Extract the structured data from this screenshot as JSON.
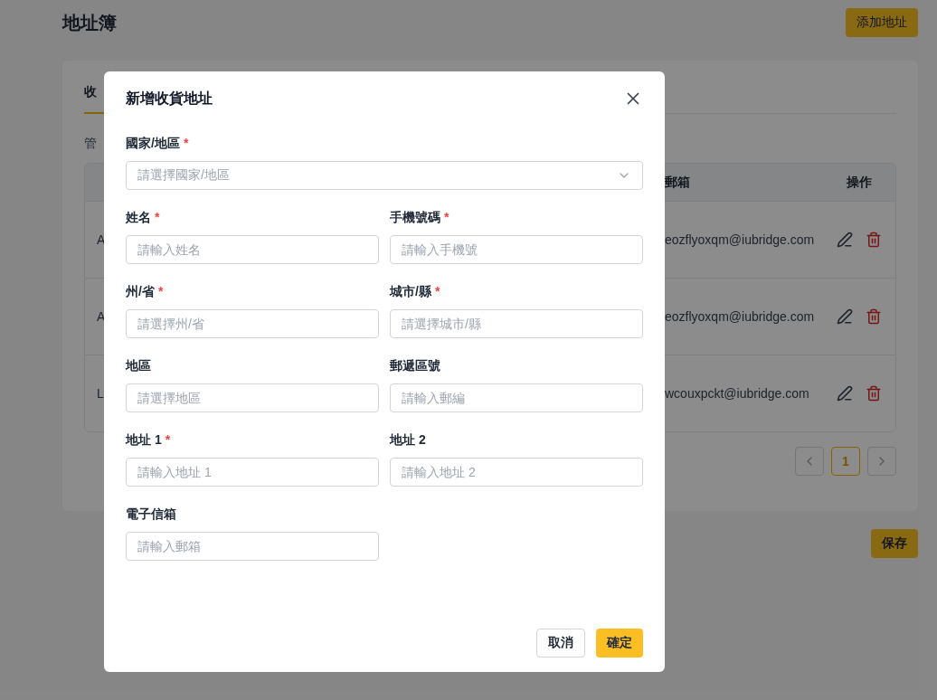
{
  "page": {
    "title": "地址簿",
    "add_button": "添加地址",
    "tabs": [
      {
        "label": "收",
        "selected": true
      }
    ],
    "description": "管",
    "table": {
      "columns": [
        "郵箱",
        "操作"
      ],
      "rows": [
        {
          "column_1": "A",
          "email": "eozflyoxqm@iubridge.com"
        },
        {
          "column_1": "A",
          "email": "eozflyoxqm@iubridge.com"
        },
        {
          "column_1": "L",
          "email": "wcouxpckt@iubridge.com"
        }
      ]
    },
    "pagination": [
      {
        "label": "1",
        "selected": true
      }
    ],
    "save_button": "保存"
  },
  "modal": {
    "title": "新增收貨地址",
    "required_mark": "*",
    "fields": [
      {
        "kind": "select",
        "label": "國家/地區",
        "required": true,
        "placeholder": "請選擇國家/地區"
      },
      {
        "kind": "input",
        "label": "姓名",
        "required": true,
        "placeholder": "請輸入姓名"
      },
      {
        "kind": "input",
        "label": "手機號碼",
        "required": true,
        "placeholder": "請輸入手機號"
      },
      {
        "kind": "input",
        "label": "州/省",
        "required": true,
        "placeholder": "請選擇州/省"
      },
      {
        "kind": "input",
        "label": "城市/縣",
        "required": true,
        "placeholder": "請選擇城市/縣"
      },
      {
        "kind": "input",
        "label": "地區",
        "required": false,
        "placeholder": "請選擇地區"
      },
      {
        "kind": "input",
        "label": "郵遞區號",
        "required": false,
        "placeholder": "請輸入郵編"
      },
      {
        "kind": "input",
        "label": "地址 1",
        "required": true,
        "placeholder": "請輸入地址 1"
      },
      {
        "kind": "input",
        "label": "地址 2",
        "required": false,
        "placeholder": "請輸入地址 2"
      },
      {
        "kind": "input",
        "label": "電子信箱",
        "required": false,
        "placeholder": "請輸入郵箱"
      }
    ],
    "cancel_button": "取消",
    "confirm_button": "確定"
  }
}
